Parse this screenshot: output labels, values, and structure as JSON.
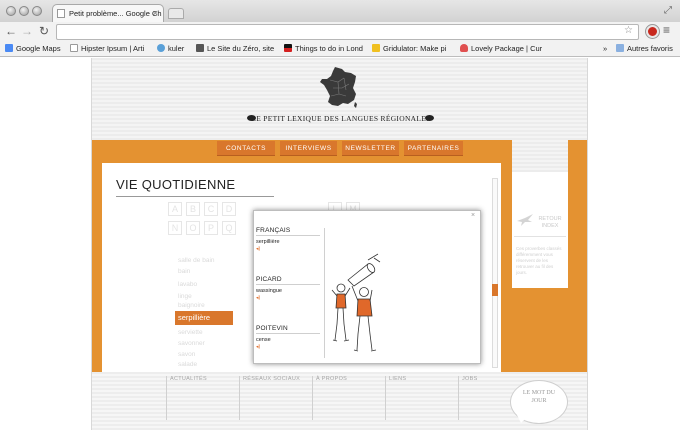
{
  "browser": {
    "tab_title": "Petit problème... Google Ch",
    "tab_close": "×",
    "url": "",
    "bookmarks": [
      {
        "label": "Google Maps",
        "color": "#4a8af4"
      },
      {
        "label": "Hipster Ipsum | Arti",
        "color": "#ffffff"
      },
      {
        "label": "kuler",
        "color": "#5aa0d8"
      },
      {
        "label": "Le Site du Zéro, site",
        "color": "#555555"
      },
      {
        "label": "Things to do in Lond",
        "color": "#d42020"
      },
      {
        "label": "Gridulator: Make pi",
        "color": "#f0c020"
      },
      {
        "label": "Lovely Package | Cur",
        "color": "#e05050"
      }
    ],
    "bookmarks_overflow": "»",
    "other_bookmarks": "Autres favoris"
  },
  "site": {
    "title": "LE PETIT LEXIQUE DES LANGUES RÉGIONALES",
    "nav": [
      "CONTACTS",
      "INTERVIEWS",
      "NEWSLETTER",
      "PARTENAIRES"
    ],
    "accent": "#e49231",
    "accent_dark": "#d9772c"
  },
  "main": {
    "section_title": "VIE QUOTIDIENNE",
    "letters_row1": [
      "A",
      "B",
      "C",
      "D"
    ],
    "letters_row1b": [
      "L",
      "M"
    ],
    "letters_row2": [
      "N",
      "O",
      "P",
      "Q"
    ],
    "faded_header": "salle de bain",
    "faded_words": [
      "bain",
      "lavabo",
      "linge",
      "baignoire"
    ],
    "selected_word": "serpillière",
    "faded_words_after": [
      "serviette",
      "savonner",
      "savon",
      "salade"
    ]
  },
  "right_panel": {
    "retour_label": "RETOUR INDEX",
    "text": "Ces proverbes classés différemment vous réservent de les retrouver au fil des jours."
  },
  "footer": {
    "columns": [
      "ACTUALITÉS",
      "RÉSEAUX SOCIAUX",
      "À PROPOS",
      "LIENS",
      "JOBS"
    ],
    "mot_du_jour": "LE MOT DU JOUR"
  },
  "modal": {
    "close": "×",
    "sections": [
      {
        "language": "FRANÇAIS",
        "word": "serpillière"
      },
      {
        "language": "PICARD",
        "word": "wassingue"
      },
      {
        "language": "POITEVIN",
        "word": "cense"
      }
    ],
    "speaker_symbol": "◂)"
  }
}
